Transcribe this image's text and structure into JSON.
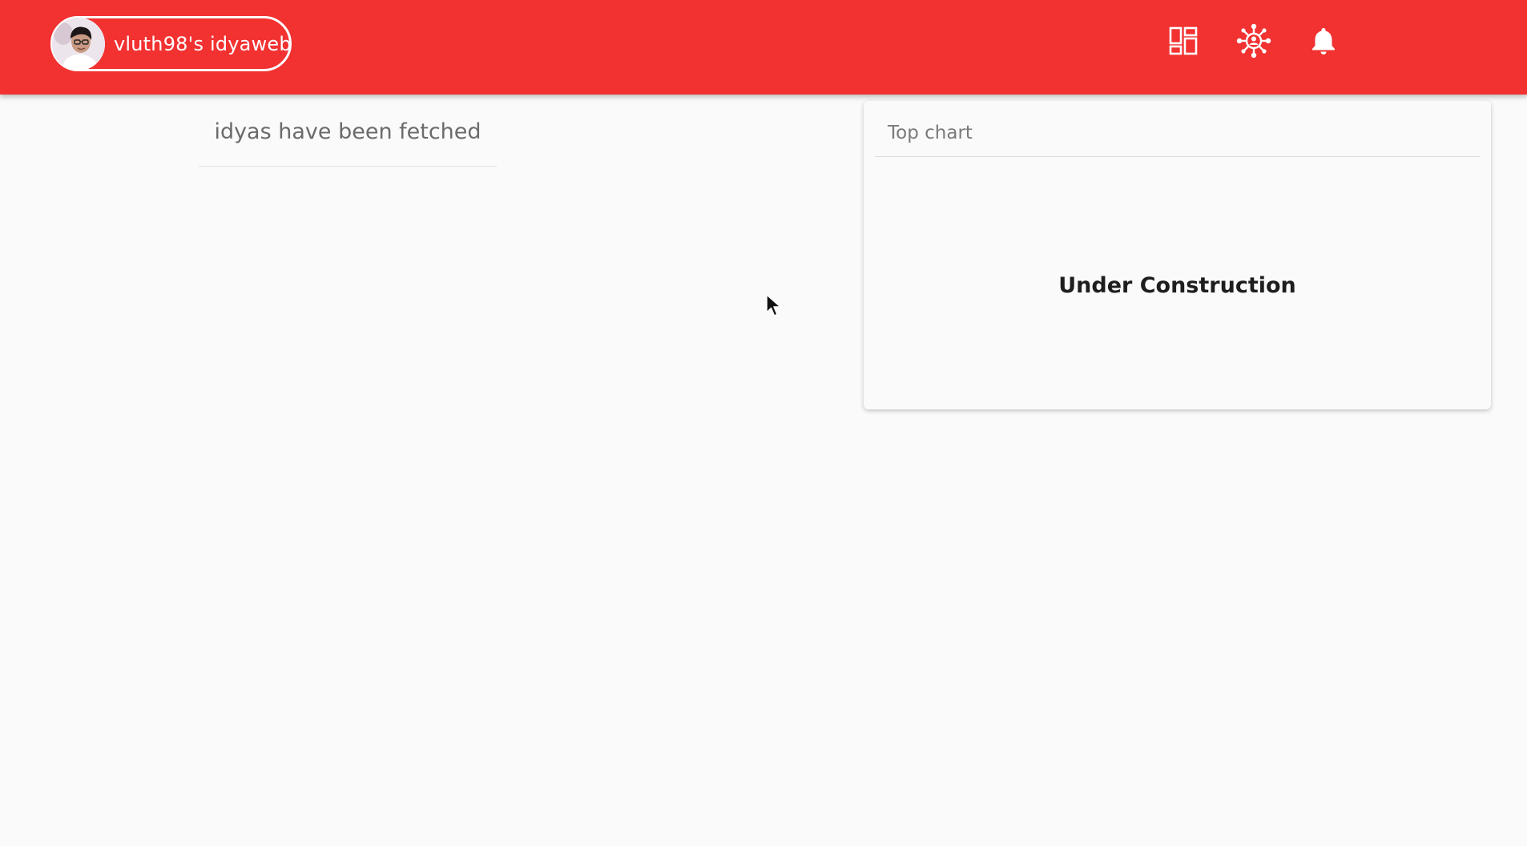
{
  "header": {
    "background_color": "#f23131",
    "profile": {
      "name": "vluth98's idyaweb",
      "avatar_icon": "avatar-photo"
    },
    "nav_icons": [
      {
        "name": "dashboard-icon"
      },
      {
        "name": "network-hub-icon"
      },
      {
        "name": "bell-icon"
      }
    ]
  },
  "feed": {
    "status": "idyas have been fetched"
  },
  "top_chart_card": {
    "title": "Top chart",
    "message": "Under Construction"
  }
}
